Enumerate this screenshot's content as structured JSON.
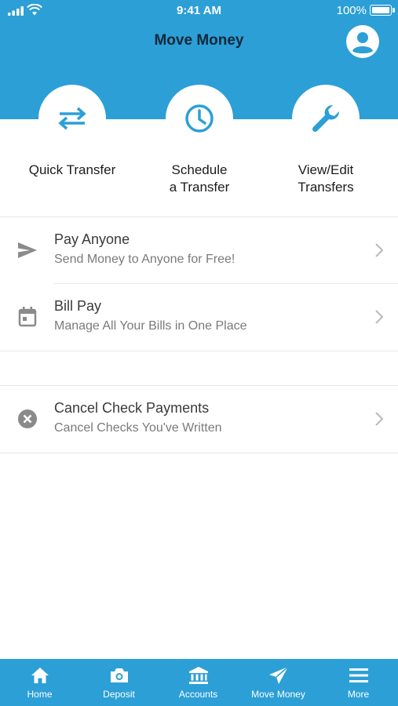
{
  "status_bar": {
    "time": "9:41 AM",
    "battery": "100%"
  },
  "header": {
    "title": "Move Money",
    "profile_icon": "user-icon"
  },
  "quick_actions": [
    {
      "label": "Quick Transfer",
      "icon": "swap-arrows-icon"
    },
    {
      "label": "Schedule\na Transfer",
      "icon": "clock-icon"
    },
    {
      "label": "View/Edit\nTransfers",
      "icon": "wrench-icon"
    }
  ],
  "list": [
    {
      "title": "Pay Anyone",
      "subtitle": "Send Money to Anyone for Free!",
      "icon": "send-icon"
    },
    {
      "title": "Bill Pay",
      "subtitle": "Manage All Your Bills in One Place",
      "icon": "calendar-icon"
    },
    {
      "title": "Cancel Check Payments",
      "subtitle": "Cancel Checks You've Written",
      "icon": "cancel-circle-icon"
    }
  ],
  "tabs": [
    {
      "label": "Home",
      "icon": "home-icon"
    },
    {
      "label": "Deposit",
      "icon": "camera-icon"
    },
    {
      "label": "Accounts",
      "icon": "bank-icon"
    },
    {
      "label": "Move Money",
      "icon": "paper-plane-icon",
      "active": true
    },
    {
      "label": "More",
      "icon": "menu-icon"
    }
  ],
  "colors": {
    "brand": "#2c9fd6",
    "title_text": "#11283a",
    "row_icon": "#8a8a8a"
  }
}
